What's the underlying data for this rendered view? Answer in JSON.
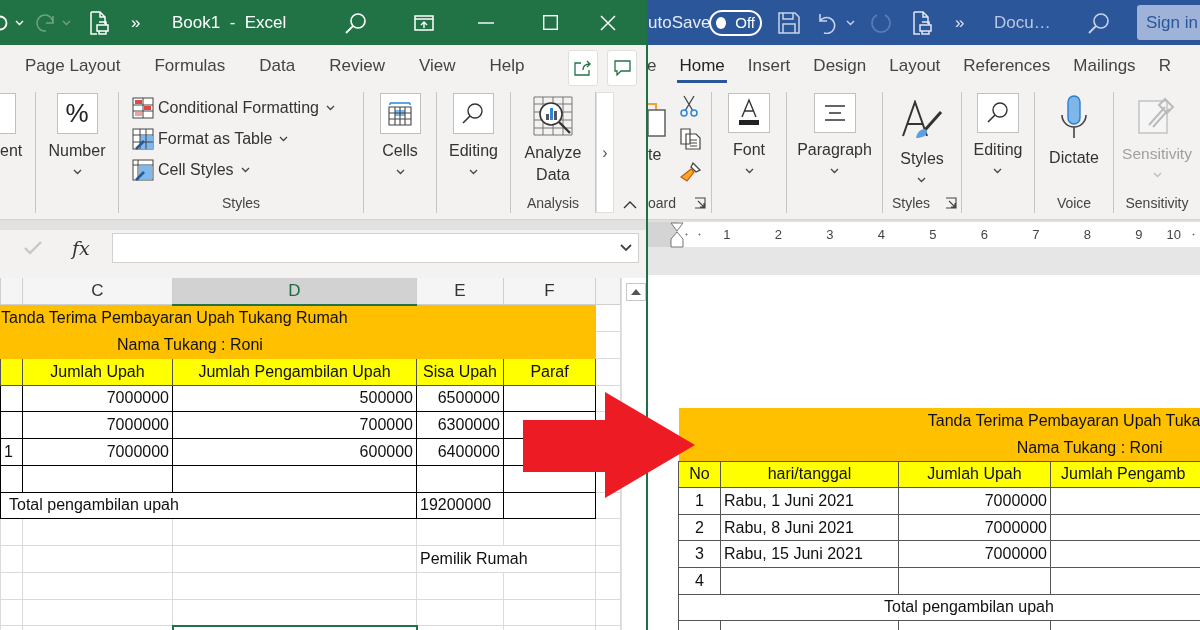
{
  "excel": {
    "title_bar": {
      "overflow": "»",
      "title": "Book1  -  Excel"
    },
    "tabs": [
      {
        "label": "Page Layout",
        "selected": false
      },
      {
        "label": "Formulas",
        "selected": false
      },
      {
        "label": "Data",
        "selected": false
      },
      {
        "label": "Review",
        "selected": false
      },
      {
        "label": "View",
        "selected": false
      },
      {
        "label": "Help",
        "selected": false
      }
    ],
    "ribbon": {
      "alignment": "ent",
      "number_glyph": "%",
      "number": "Number",
      "styles_items": [
        "Conditional Formatting",
        "Format as Table",
        "Cell Styles"
      ],
      "styles_group": "Styles",
      "cells": "Cells",
      "editing": "Editing",
      "analyze": "Analyze Data",
      "analysis_group": "Analysis",
      "scroll": "›"
    },
    "formula_bar": {
      "function": "fx"
    },
    "columns": [
      {
        "label": "C",
        "selected": false
      },
      {
        "label": "D",
        "selected": true
      },
      {
        "label": "E",
        "selected": false
      },
      {
        "label": "F",
        "selected": false
      }
    ],
    "sheet": {
      "title": "Tanda Terima Pembayaran Upah Tukang Rumah",
      "subtitle": "Nama Tukang : Roni",
      "header": [
        "Jumlah Upah",
        "Jumlah Pengambilan Upah",
        "Sisa Upah",
        "Paraf"
      ],
      "rows": [
        {
          "kind": "data",
          "jumlah_upah": "7000000",
          "pengambilan": "500000",
          "sisa": "6500000"
        },
        {
          "kind": "data",
          "jumlah_upah": "7000000",
          "pengambilan": "700000",
          "sisa": "6300000"
        },
        {
          "kind": "data",
          "column_b": "1",
          "jumlah_upah": "7000000",
          "pengambilan": "600000",
          "sisa": "6400000"
        },
        {
          "kind": "blank"
        }
      ],
      "total": {
        "label": "Total pengambilan upah",
        "value": "19200000"
      },
      "signature": "Pemilik Rumah"
    }
  },
  "word": {
    "title_bar": {
      "autosave": "utoSave",
      "toggle": {
        "label": "Off",
        "on": false
      },
      "overflow": "»",
      "title": "Docu…",
      "sign_in": "Sign in"
    },
    "tabs": [
      {
        "label": "e",
        "selected": false
      },
      {
        "label": "Home",
        "selected": true
      },
      {
        "label": "Insert",
        "selected": false
      },
      {
        "label": "Design",
        "selected": false
      },
      {
        "label": "Layout",
        "selected": false
      },
      {
        "label": "References",
        "selected": false
      },
      {
        "label": "Mailings",
        "selected": false
      },
      {
        "label": "R",
        "selected": false
      }
    ],
    "ribbon": {
      "paste": "te",
      "clipboard_group": "oard",
      "font": "Font",
      "paragraph": "Paragraph",
      "styles": "Styles",
      "styles_group": "Styles",
      "editing": "Editing",
      "dictate": "Dictate",
      "voice_group": "Voice",
      "sensitivity": {
        "label": "Sensitivity",
        "disabled": true
      },
      "sensitivity_group": "Sensitivity"
    },
    "ruler": [
      "1",
      "2",
      "3",
      "4",
      "5",
      "6",
      "7",
      "8",
      "9",
      "10"
    ],
    "document": {
      "title": "Tanda Terima Pembayaran Upah Tuka",
      "subtitle": "Nama Tukang : Roni",
      "header": [
        "No",
        "hari/tanggal",
        "Jumlah Upah",
        "Jumlah Pengamb"
      ],
      "rows": [
        {
          "no": "1",
          "date": "Rabu, 1 Juni 2021",
          "amount": "7000000"
        },
        {
          "no": "2",
          "date": "Rabu, 8 Juni 2021",
          "amount": "7000000"
        },
        {
          "no": "3",
          "date": "Rabu, 15 Juni 2021",
          "amount": "7000000"
        },
        {
          "no": "4"
        }
      ],
      "total": "Total pengambilan upah"
    }
  }
}
